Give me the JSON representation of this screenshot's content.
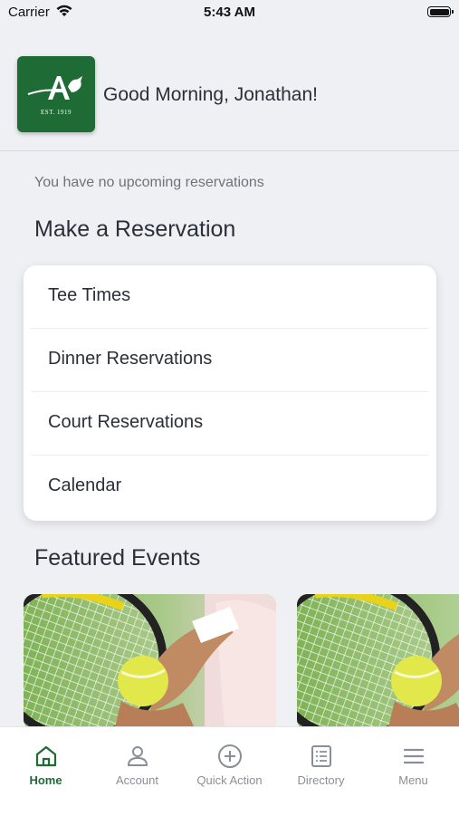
{
  "status_bar": {
    "carrier": "Carrier",
    "time": "5:43 AM"
  },
  "header": {
    "logo_est": "EST. 1919",
    "greeting": "Good Morning, Jonathan!"
  },
  "reservations": {
    "empty_message": "You have no upcoming reservations"
  },
  "make_reservation": {
    "title": "Make a Reservation",
    "items": [
      {
        "label": "Tee Times"
      },
      {
        "label": "Dinner Reservations"
      },
      {
        "label": "Court Reservations"
      },
      {
        "label": "Calendar"
      }
    ]
  },
  "featured_events": {
    "title": "Featured Events"
  },
  "tab_bar": {
    "tabs": [
      {
        "label": "Home",
        "icon": "home-icon",
        "active": true
      },
      {
        "label": "Account",
        "icon": "person-icon",
        "active": false
      },
      {
        "label": "Quick Action",
        "icon": "plus-circle-icon",
        "active": false
      },
      {
        "label": "Directory",
        "icon": "list-document-icon",
        "active": false
      },
      {
        "label": "Menu",
        "icon": "hamburger-icon",
        "active": false
      }
    ]
  },
  "colors": {
    "brand_green": "#1f6b35",
    "background": "#eef0f3",
    "text": "#2b2f38",
    "muted": "#8a8e96"
  }
}
